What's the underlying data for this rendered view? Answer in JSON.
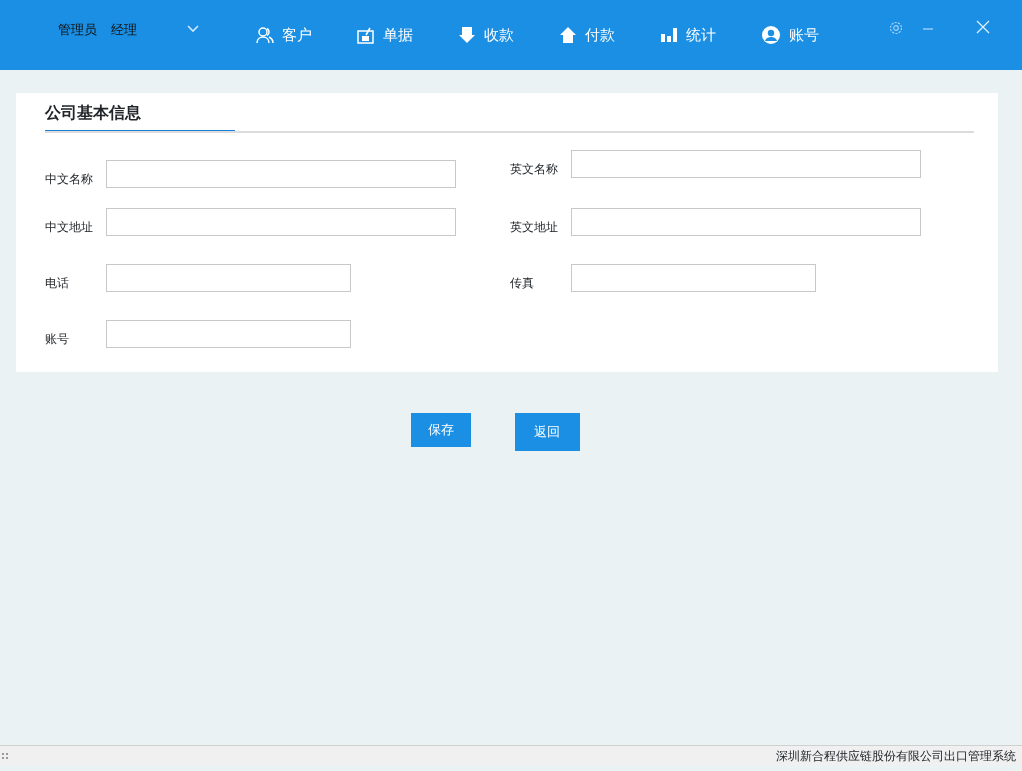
{
  "user": {
    "name": "管理员",
    "role": "经理"
  },
  "nav": [
    {
      "kind": "customer",
      "label": "客户"
    },
    {
      "kind": "document",
      "label": "单据"
    },
    {
      "kind": "receive",
      "label": "收款"
    },
    {
      "kind": "pay",
      "label": "付款"
    },
    {
      "kind": "stats",
      "label": "统计"
    },
    {
      "kind": "account",
      "label": "账号"
    }
  ],
  "panel": {
    "title": "公司基本信息",
    "left": [
      {
        "label": "中文名称",
        "kind": "wide"
      },
      {
        "label": "中文地址",
        "kind": "wide"
      },
      {
        "label": "电话",
        "kind": "narrow"
      },
      {
        "label": "账号",
        "kind": "narrow"
      }
    ],
    "right": [
      {
        "label": "英文名称",
        "kind": "wide"
      },
      {
        "label": "英文地址",
        "kind": "wide"
      },
      {
        "label": "传真",
        "kind": "narrow"
      }
    ]
  },
  "buttons": [
    {
      "label": "保存"
    },
    {
      "label": "返回"
    }
  ],
  "status_bar": "深圳新合程供应链股份有限公司出口管理系统"
}
